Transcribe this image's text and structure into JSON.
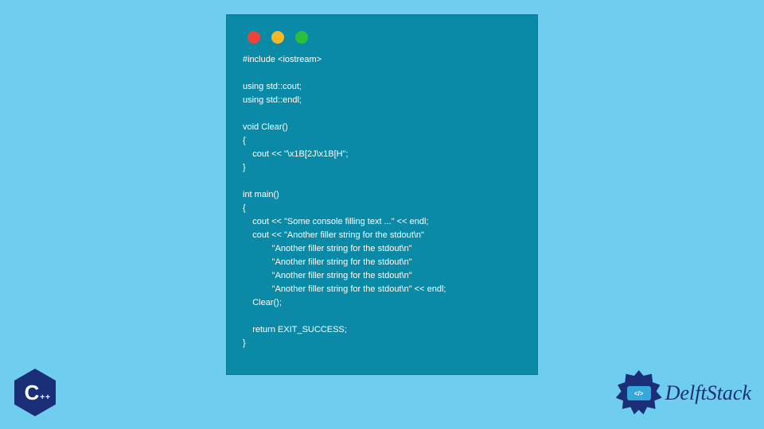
{
  "code": {
    "text": "#include <iostream>\n\nusing std::cout;\nusing std::endl;\n\nvoid Clear()\n{\n    cout << \"\\x1B[2J\\x1B[H\";\n}\n\nint main()\n{\n    cout << \"Some console filling text ...\" << endl;\n    cout << \"Another filler string for the stdout\\n\"\n            \"Another filler string for the stdout\\n\"\n            \"Another filler string for the stdout\\n\"\n            \"Another filler string for the stdout\\n\"\n            \"Another filler string for the stdout\\n\" << endl;\n    Clear();\n\n    return EXIT_SUCCESS;\n}"
  },
  "badge": {
    "letter": "C",
    "pp": "++"
  },
  "logo": {
    "inner": "</>",
    "text": "DelftStack"
  },
  "colors": {
    "page_bg": "#6fcdf0",
    "window_bg": "#0b8aa8",
    "dot_red": "#e9433a",
    "dot_yellow": "#f3b92a",
    "dot_green": "#2fbe3b",
    "brand_navy": "#1a2f78",
    "brand_blue": "#35a8dc"
  }
}
